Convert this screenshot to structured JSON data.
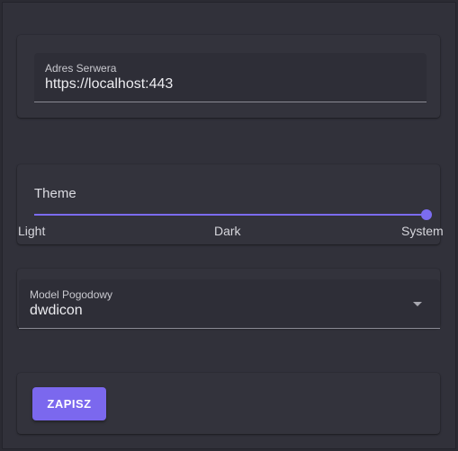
{
  "server": {
    "label": "Adres Serwera",
    "value": "https://localhost:443"
  },
  "theme": {
    "title": "Theme",
    "options": [
      "Light",
      "Dark",
      "System"
    ],
    "selected_index": 2,
    "accent_color": "#7b6cf0"
  },
  "model": {
    "label": "Model Pogodowy",
    "value": "dwdicon",
    "icon": "chevron-down-icon"
  },
  "actions": {
    "save_label": "ZAPISZ",
    "save_color": "#7b68ee"
  }
}
